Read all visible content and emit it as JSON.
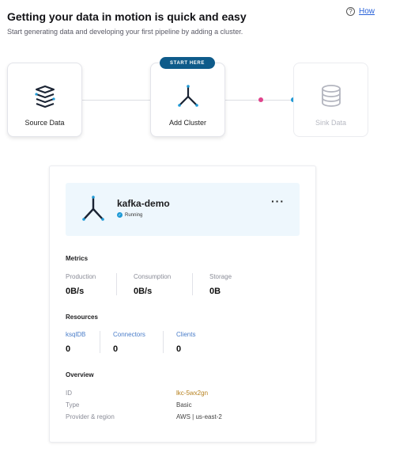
{
  "header": {
    "title": "Getting your data in motion is quick and easy",
    "subtitle": "Start generating data and developing your first pipeline by adding a cluster.",
    "help_link": "How"
  },
  "steps": [
    {
      "label": "Source Data",
      "icon": "layers-icon"
    },
    {
      "label": "Add Cluster",
      "icon": "cluster-icon",
      "badge": "START HERE"
    },
    {
      "label": "Sink Data",
      "icon": "database-icon"
    }
  ],
  "cluster": {
    "name": "kafka-demo",
    "status": "Running",
    "more": "···"
  },
  "metrics": {
    "title": "Metrics",
    "items": [
      {
        "label": "Production",
        "value": "0B/s"
      },
      {
        "label": "Consumption",
        "value": "0B/s"
      },
      {
        "label": "Storage",
        "value": "0B"
      }
    ]
  },
  "resources": {
    "title": "Resources",
    "items": [
      {
        "label": "ksqlDB",
        "value": "0"
      },
      {
        "label": "Connectors",
        "value": "0"
      },
      {
        "label": "Clients",
        "value": "0"
      }
    ]
  },
  "overview": {
    "title": "Overview",
    "rows": [
      {
        "key": "ID",
        "value": "lkc-5wx2gn"
      },
      {
        "key": "Type",
        "value": "Basic"
      },
      {
        "key": "Provider & region",
        "value": "AWS | us-east-2"
      }
    ]
  },
  "colors": {
    "badge": "#0e5b8a",
    "accent_blue": "#1f9ad6",
    "pink_dot": "#e0448c",
    "cluster_bg": "#eef7fd"
  }
}
